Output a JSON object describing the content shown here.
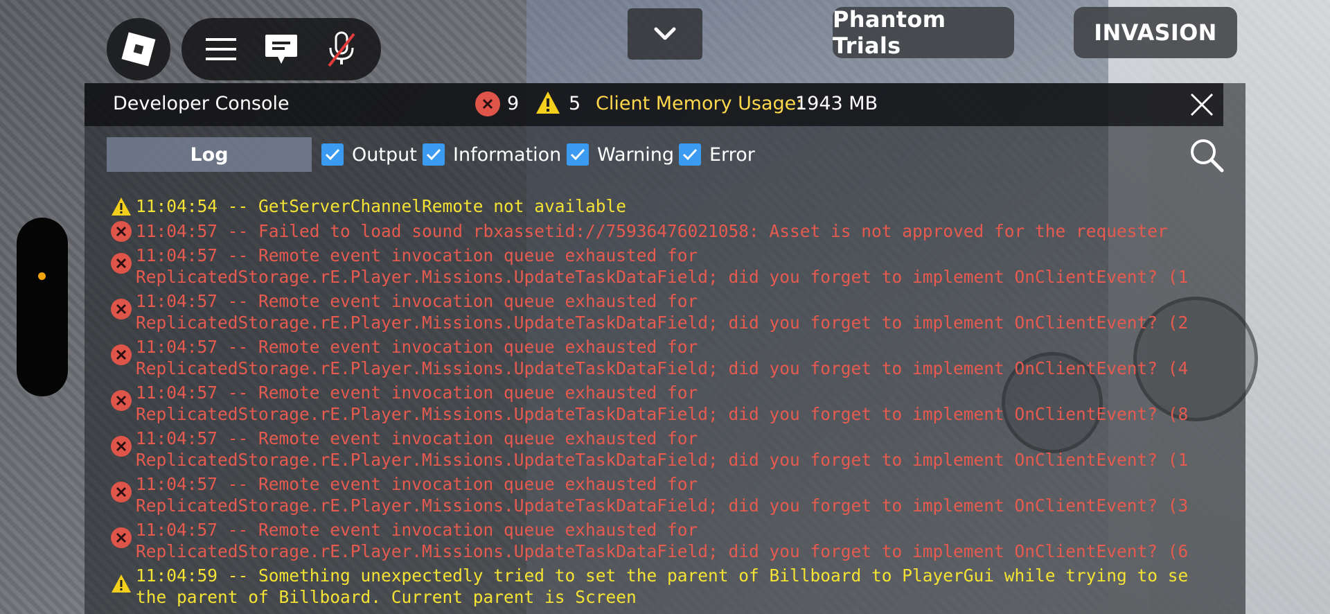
{
  "topbar": {
    "roblox_menu_icon": "roblox-logo-icon",
    "menu_icon": "hamburger-icon",
    "chat_icon": "chat-bubble-icon",
    "mic_icon": "mic-muted-icon",
    "dropdown_icon": "chevron-down-icon",
    "phantom_trials_label": "Phantom Trials",
    "invasion_label": "INVASION"
  },
  "console": {
    "title": "Developer Console",
    "error_count": "9",
    "warning_count": "5",
    "memory_label": "Client Memory Usage:",
    "memory_value": "1943 MB",
    "log_tab": "Log",
    "filters": [
      {
        "label": "Output",
        "checked": true
      },
      {
        "label": "Information",
        "checked": true
      },
      {
        "label": "Warning",
        "checked": true
      },
      {
        "label": "Error",
        "checked": true
      }
    ],
    "colors": {
      "error": "#e65a50",
      "warning": "#f4e234",
      "memory_label": "#ffd84d",
      "checkbox": "#3a9bf0"
    }
  },
  "log": [
    {
      "level": "warning",
      "lines": [
        "11:04:54 -- GetServerChannelRemote not available"
      ]
    },
    {
      "level": "error",
      "lines": [
        "11:04:57 -- Failed to load sound rbxassetid://75936476021058: Asset is not approved for the requester"
      ]
    },
    {
      "level": "error",
      "lines": [
        "11:04:57 -- Remote event invocation queue exhausted for",
        "ReplicatedStorage.rE.Player.Missions.UpdateTaskDataField; did you forget to implement OnClientEvent? (1"
      ]
    },
    {
      "level": "error",
      "lines": [
        "11:04:57 -- Remote event invocation queue exhausted for",
        "ReplicatedStorage.rE.Player.Missions.UpdateTaskDataField; did you forget to implement OnClientEvent? (2"
      ]
    },
    {
      "level": "error",
      "lines": [
        "11:04:57 -- Remote event invocation queue exhausted for",
        "ReplicatedStorage.rE.Player.Missions.UpdateTaskDataField; did you forget to implement OnClientEvent? (4"
      ]
    },
    {
      "level": "error",
      "lines": [
        "11:04:57 -- Remote event invocation queue exhausted for",
        "ReplicatedStorage.rE.Player.Missions.UpdateTaskDataField; did you forget to implement OnClientEvent? (8"
      ]
    },
    {
      "level": "error",
      "lines": [
        "11:04:57 -- Remote event invocation queue exhausted for",
        "ReplicatedStorage.rE.Player.Missions.UpdateTaskDataField; did you forget to implement OnClientEvent? (1"
      ]
    },
    {
      "level": "error",
      "lines": [
        "11:04:57 -- Remote event invocation queue exhausted for",
        "ReplicatedStorage.rE.Player.Missions.UpdateTaskDataField; did you forget to implement OnClientEvent? (3"
      ]
    },
    {
      "level": "error",
      "lines": [
        "11:04:57 -- Remote event invocation queue exhausted for",
        "ReplicatedStorage.rE.Player.Missions.UpdateTaskDataField; did you forget to implement OnClientEvent? (6"
      ]
    },
    {
      "level": "warning",
      "lines": [
        "11:04:59 -- Something unexpectedly tried to set the parent of Billboard to PlayerGui while trying to se",
        "the parent of Billboard. Current parent is Screen"
      ]
    }
  ]
}
